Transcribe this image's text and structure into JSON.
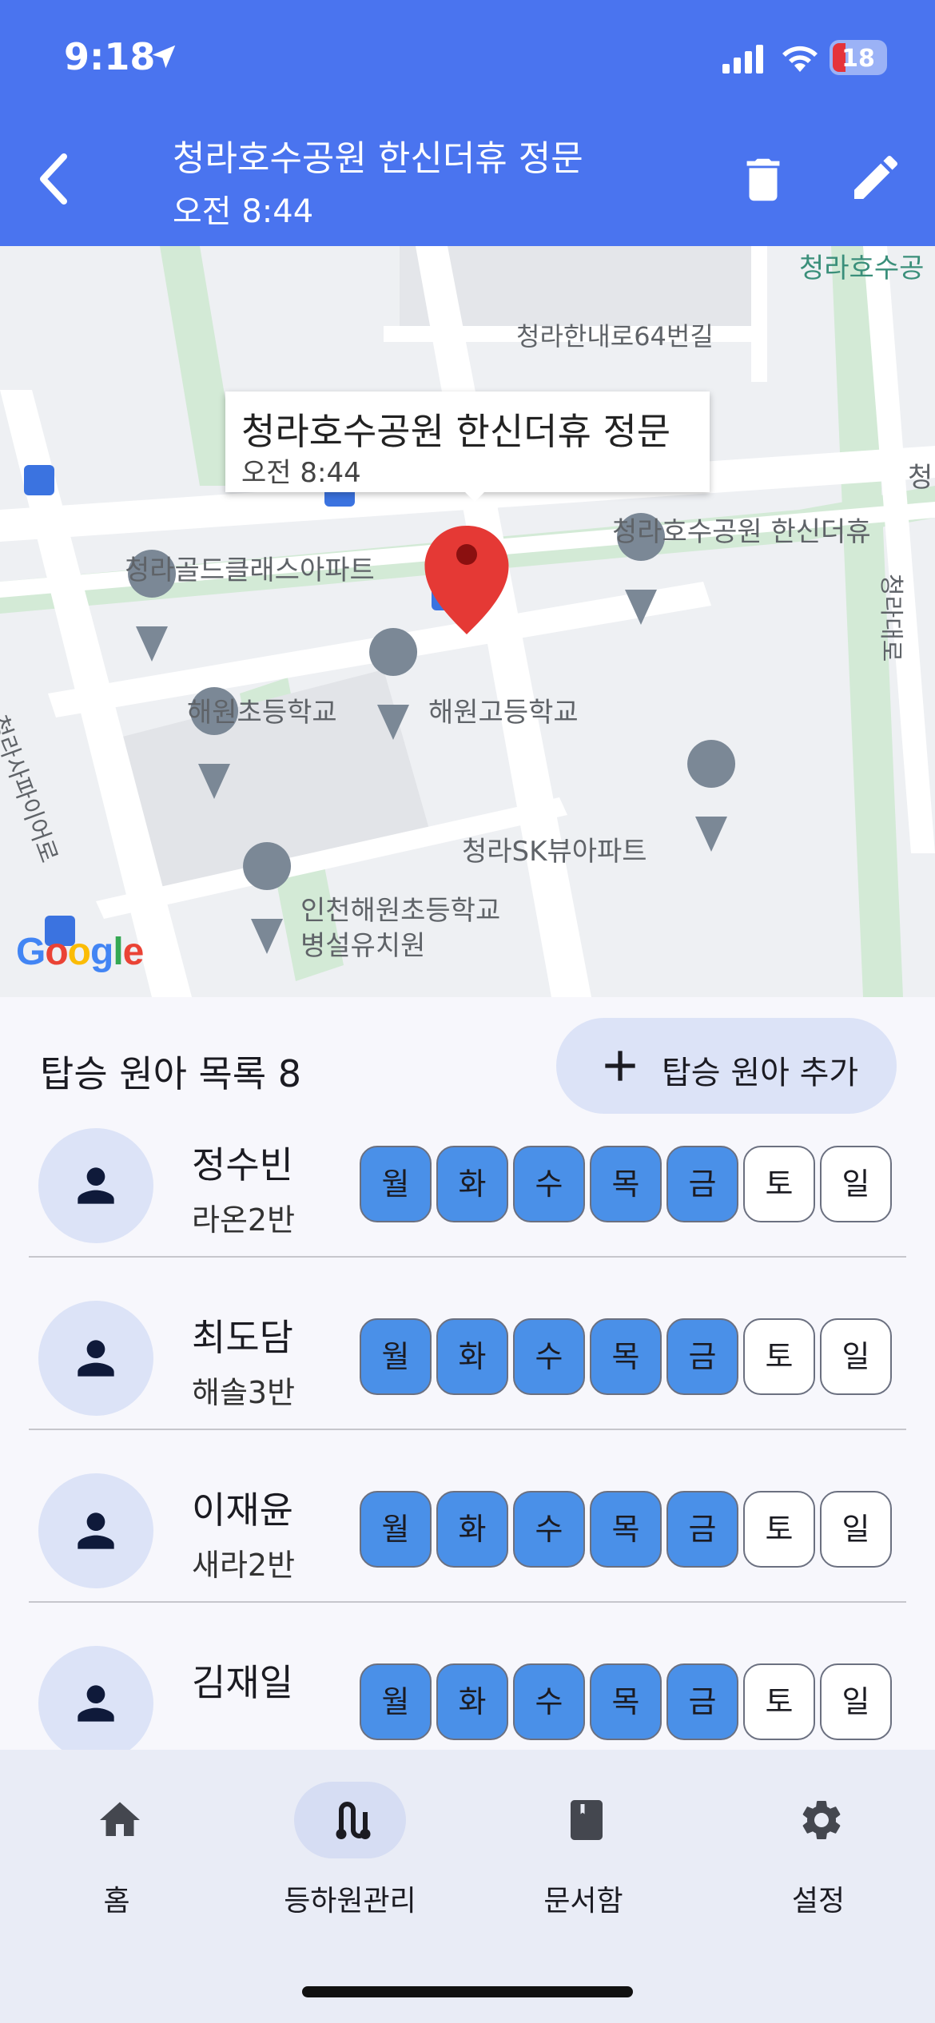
{
  "status_bar": {
    "time": "9:18",
    "battery": "18"
  },
  "header": {
    "title": "청라호수공원 한신더휴 정문",
    "subtitle": "오전 8:44"
  },
  "map": {
    "popup_title": "청라호수공원 한신더휴 정문",
    "popup_time": "오전 8:44",
    "labels": {
      "top_right": "청라호수공",
      "road_64": "청라한내로64번길",
      "hansin": "청라호수공원 한신더휴",
      "gold": "청라골드클래스아파트",
      "haewon_elem": "해원초등학교",
      "haewon_high": "해원고등학교",
      "sk": "청라SK뷰아파트",
      "kinder_1": "인천해원초등학교",
      "kinder_2": "병설유치원",
      "sapphire": "청라사파이어로",
      "cheongra_daero": "청라대로",
      "cheong_edge": "청"
    },
    "google": "Google"
  },
  "list": {
    "title": "탑승 원아 목록 8",
    "add_label": "탑승 원아 추가",
    "day_labels": [
      "월",
      "화",
      "수",
      "목",
      "금",
      "토",
      "일"
    ],
    "children": [
      {
        "name": "정수빈",
        "class": "라온2반",
        "days": [
          1,
          1,
          1,
          1,
          1,
          0,
          0
        ]
      },
      {
        "name": "최도담",
        "class": "해솔3반",
        "days": [
          1,
          1,
          1,
          1,
          1,
          0,
          0
        ]
      },
      {
        "name": "이재윤",
        "class": "새라2반",
        "days": [
          1,
          1,
          1,
          1,
          1,
          0,
          0
        ]
      },
      {
        "name": "김재일",
        "class": "",
        "days": [
          1,
          1,
          1,
          1,
          1,
          0,
          0
        ]
      }
    ]
  },
  "nav": {
    "home": "홈",
    "commute": "등하원관리",
    "documents": "문서함",
    "settings": "설정"
  },
  "colors": {
    "primary": "#4a74ef",
    "day_on": "#4a90e8",
    "chip_bg": "#dce3f7",
    "pin_red": "#e53935"
  }
}
